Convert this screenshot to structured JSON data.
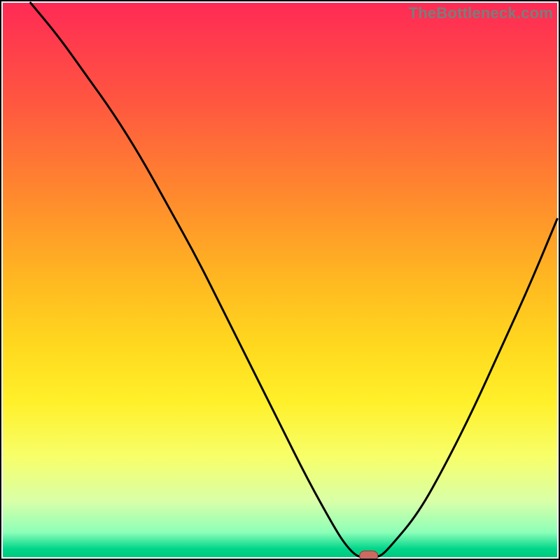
{
  "watermark": "TheBottleneck.com",
  "chart_data": {
    "type": "line",
    "title": "",
    "xlabel": "",
    "ylabel": "",
    "xlim": [
      0,
      100
    ],
    "ylim": [
      0,
      100
    ],
    "x": [
      5,
      10,
      15,
      20,
      25,
      30,
      35,
      40,
      45,
      50,
      55,
      60,
      62,
      64,
      66,
      68,
      70,
      75,
      80,
      85,
      90,
      95,
      100
    ],
    "values": [
      100,
      94,
      87,
      80,
      72,
      63,
      54,
      44,
      34,
      24,
      14,
      5,
      2,
      0,
      0,
      0,
      2,
      8,
      17,
      27,
      38,
      49,
      61
    ],
    "marker": {
      "x": 66,
      "y": 0,
      "label": ""
    },
    "gradient_bands": [
      {
        "color": "#ff2a55",
        "position": 0.0
      },
      {
        "color": "#ff5740",
        "position": 0.18
      },
      {
        "color": "#ff8a2d",
        "position": 0.35
      },
      {
        "color": "#ffb821",
        "position": 0.5
      },
      {
        "color": "#ffd91e",
        "position": 0.62
      },
      {
        "color": "#fff02a",
        "position": 0.72
      },
      {
        "color": "#f7ff6a",
        "position": 0.82
      },
      {
        "color": "#d8ffa8",
        "position": 0.9
      },
      {
        "color": "#8dffb8",
        "position": 0.955
      },
      {
        "color": "#00d68a",
        "position": 0.985
      },
      {
        "color": "#00c87e",
        "position": 1.0
      }
    ]
  },
  "colors": {
    "frame": "#000000",
    "curve": "#000000",
    "marker_fill": "#cc6a62",
    "marker_stroke": "#8a3c34"
  }
}
